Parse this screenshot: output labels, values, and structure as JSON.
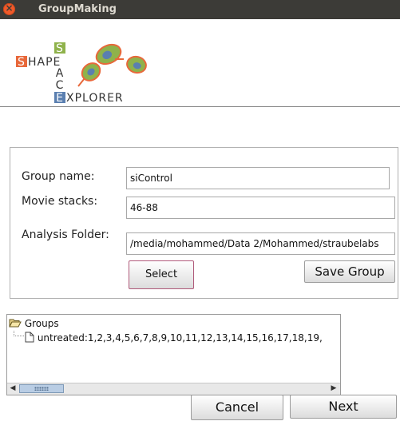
{
  "window": {
    "title": "GroupMaking",
    "close_glyph": "×"
  },
  "logo": {
    "line1": "HAPE",
    "line1_initial": "S",
    "col_letters": [
      "S",
      "A",
      "C"
    ],
    "line4_initial": "E",
    "line4": "XPLORER"
  },
  "form": {
    "group_name_label": "Group name:",
    "group_name_value": "siControl",
    "movie_stacks_label": "Movie stacks:",
    "movie_stacks_value": "46-88",
    "analysis_folder_label": "Analysis Folder:",
    "analysis_folder_value": "/media/mohammed/Data 2/Mohammed/straubelabs",
    "select_label": "Select",
    "save_group_label": "Save Group"
  },
  "tree": {
    "root_label": "Groups",
    "items": [
      "untreated:1,2,3,4,5,6,7,8,9,10,11,12,13,14,15,16,17,18,19,"
    ]
  },
  "footer": {
    "cancel_label": "Cancel",
    "next_label": "Next"
  },
  "colors": {
    "titlebar": "#3c3b37",
    "close": "#f05a2a",
    "logo_orange": "#e8683a",
    "logo_green": "#8fb24b",
    "logo_blue": "#5a7fb0"
  }
}
